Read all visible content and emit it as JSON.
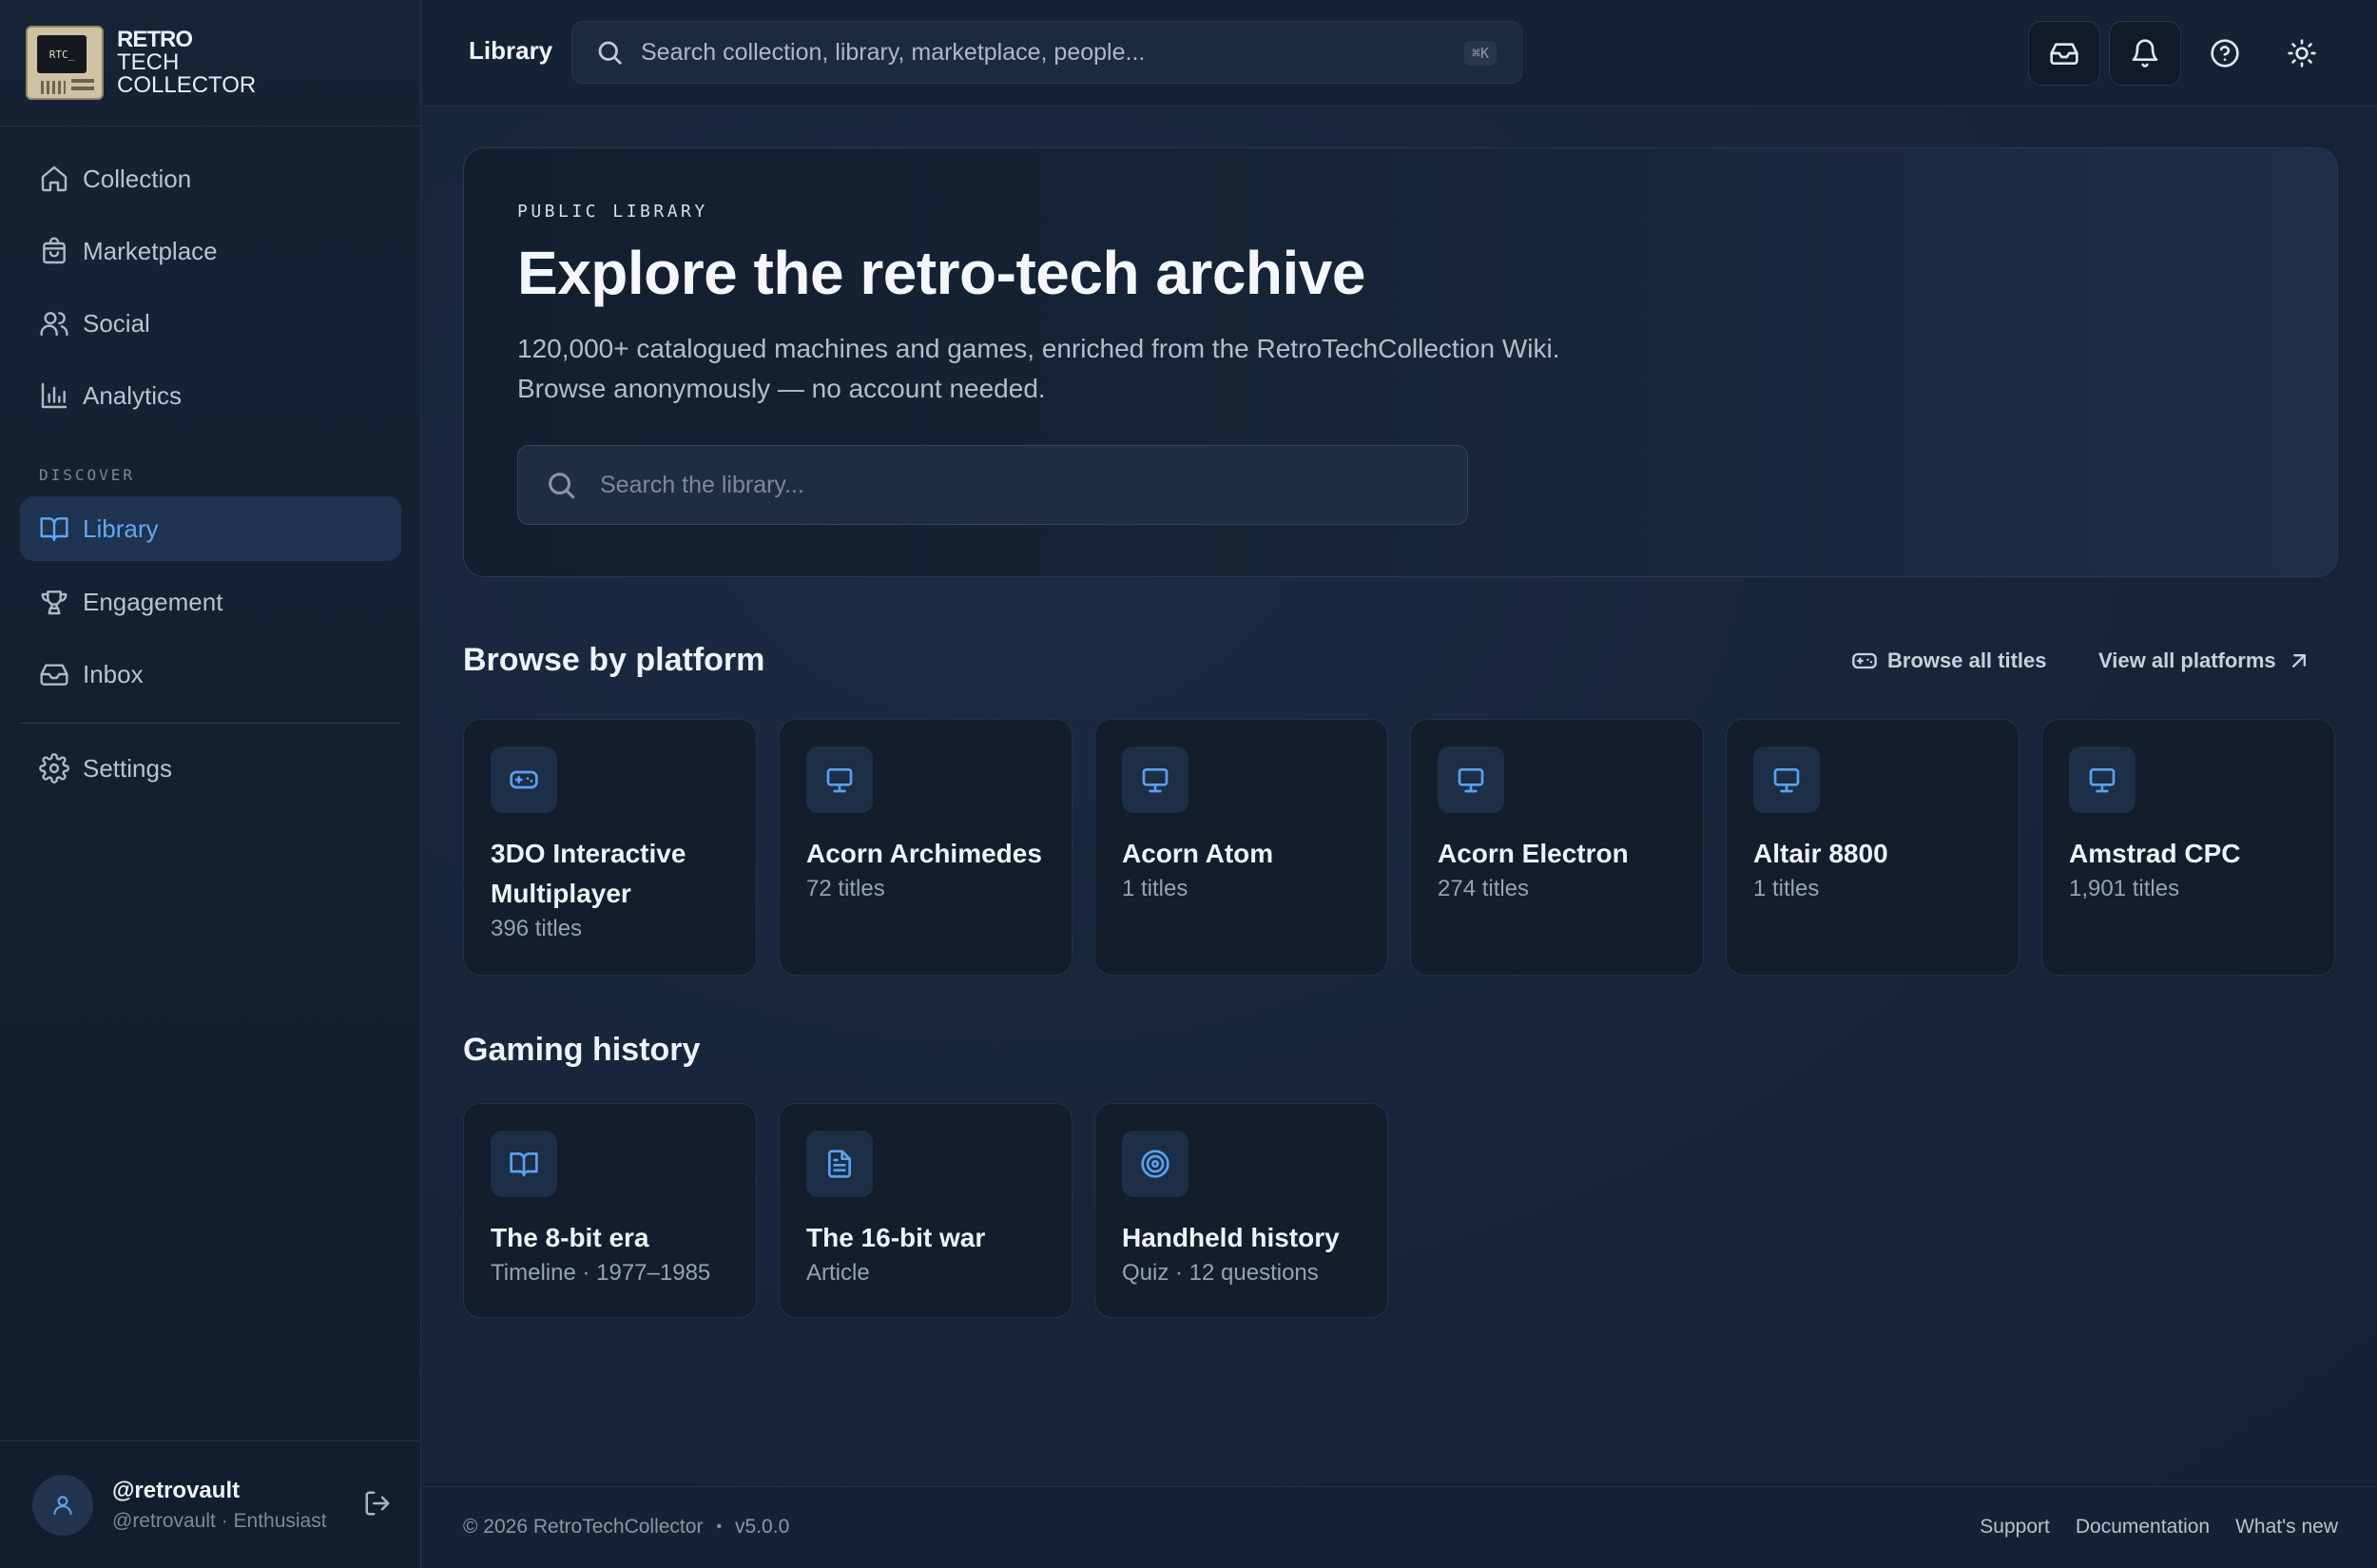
{
  "brand": {
    "line1": "RETRO",
    "line2": "TECH",
    "line3": "COLLECTOR",
    "logo_screen": "RTC_"
  },
  "sidebar": {
    "items": [
      {
        "label": "Collection",
        "icon": "home-icon"
      },
      {
        "label": "Marketplace",
        "icon": "shopping-bag-icon"
      },
      {
        "label": "Social",
        "icon": "users-icon"
      },
      {
        "label": "Analytics",
        "icon": "bar-chart-icon"
      },
      {
        "label": "Library",
        "icon": "book-open-icon",
        "active": true
      },
      {
        "label": "Engagement",
        "icon": "trophy-icon"
      },
      {
        "label": "Inbox",
        "icon": "inbox-icon"
      },
      {
        "label": "Settings",
        "icon": "gear-icon"
      }
    ],
    "section_label": "DISCOVER"
  },
  "user": {
    "handle": "@retrovault",
    "subtitle": "@retrovault · Enthusiast"
  },
  "topbar": {
    "title": "Library",
    "search_placeholder": "Search collection, library, marketplace, people...",
    "shortcut": "⌘K"
  },
  "hero": {
    "kicker": "PUBLIC LIBRARY",
    "title": "Explore the retro-tech archive",
    "description_line1": "120,000+ catalogued machines and games, enriched from the RetroTechCollection Wiki.",
    "description_line2": "Browse anonymously — no account needed.",
    "search_placeholder": "Search the library..."
  },
  "platforms": {
    "title": "Browse by platform",
    "browse_all": "Browse all titles",
    "view_all": "View all platforms",
    "cards": [
      {
        "name": "3DO Interactive Multiplayer",
        "count": "396 titles",
        "icon": "gamepad-icon"
      },
      {
        "name": "Acorn Archimedes",
        "count": "72 titles",
        "icon": "monitor-icon"
      },
      {
        "name": "Acorn Atom",
        "count": "1 titles",
        "icon": "monitor-icon"
      },
      {
        "name": "Acorn Electron",
        "count": "274 titles",
        "icon": "monitor-icon"
      },
      {
        "name": "Altair 8800",
        "count": "1 titles",
        "icon": "monitor-icon"
      },
      {
        "name": "Amstrad CPC",
        "count": "1,901 titles",
        "icon": "monitor-icon"
      }
    ]
  },
  "history": {
    "title": "Gaming history",
    "cards": [
      {
        "name": "The 8-bit era",
        "meta": "Timeline · 1977–1985",
        "icon": "book-open-icon"
      },
      {
        "name": "The 16-bit war",
        "meta": "Article",
        "icon": "document-icon"
      },
      {
        "name": "Handheld history",
        "meta": "Quiz · 12 questions",
        "icon": "target-icon"
      }
    ]
  },
  "footer": {
    "copyright": "© 2026 RetroTechCollector",
    "version": "v5.0.0",
    "links": [
      "Support",
      "Documentation",
      "What's new"
    ]
  },
  "colors": {
    "accent": "#5aa1ef",
    "active_nav_bg": "#1e3450",
    "background": "#172336"
  }
}
